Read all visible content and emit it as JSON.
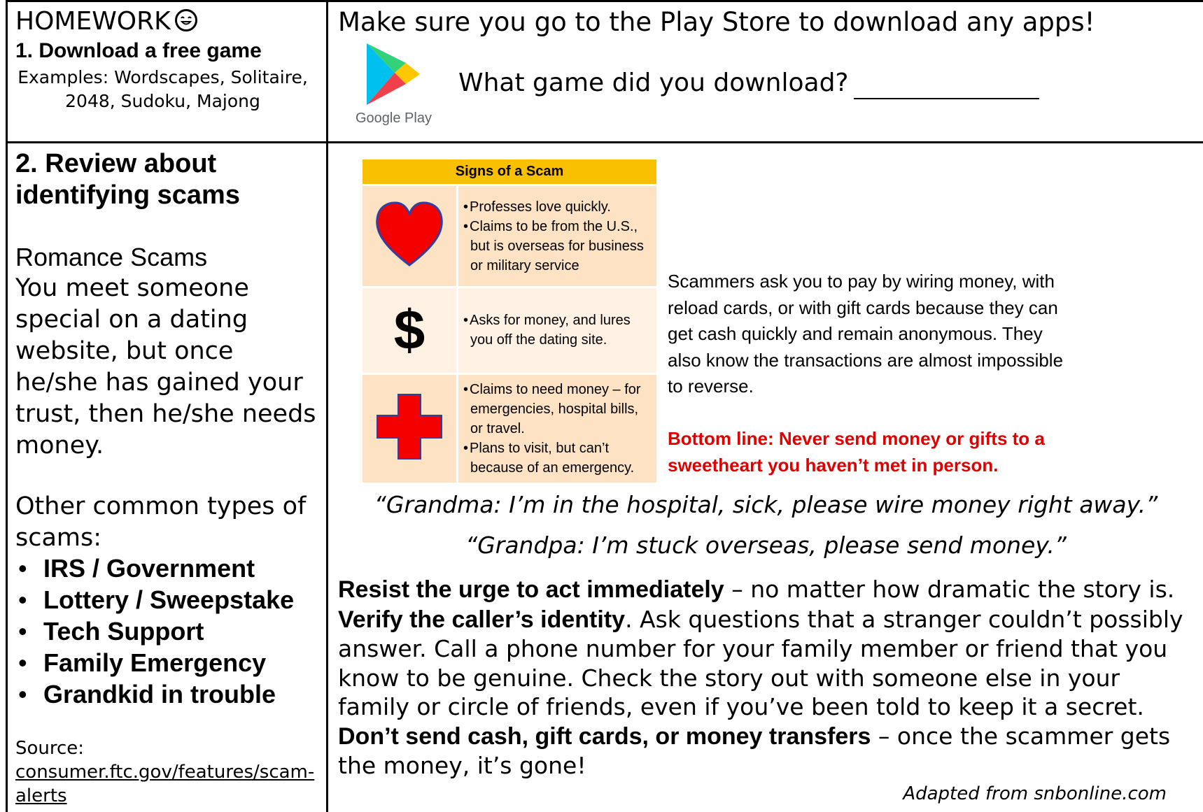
{
  "homework": {
    "title": "HOMEWORK",
    "item1": "1. Download a free game",
    "examples": "Examples: Wordscapes, Solitaire, 2048, Sudoku, Majong",
    "play_store_note": "Make sure you go to the Play Store to download any apps!",
    "logo_text": "Google Play",
    "question": "What game did you download?"
  },
  "review": {
    "title": "2. Review about identifying scams",
    "romance_title": "Romance Scams",
    "romance_body": "You meet someone special on a dating website, but once he/she has gained your trust, then he/she needs money.",
    "other_title": "Other common types of scams:",
    "types": [
      "IRS / Government",
      "Lottery / Sweepstake",
      "Tech Support",
      "Family Emergency",
      "Grandkid in trouble"
    ],
    "source_label": "Source:",
    "source_link": "consumer.ftc.gov/features/scam-alerts"
  },
  "signs_table": {
    "header": "Signs of a Scam",
    "rows": [
      {
        "icon": "heart-icon",
        "bullets": [
          "Professes love quickly.",
          "Claims to be from the U.S., but is overseas for business or military service"
        ]
      },
      {
        "icon": "$",
        "bullets": [
          "Asks for money, and lures you off the dating site."
        ]
      },
      {
        "icon": "red-cross-icon",
        "bullets": [
          "Claims to need money – for emergencies, hospital bills, or travel.",
          "Plans to visit, but can’t because of an emergency."
        ]
      }
    ]
  },
  "scam_text": "Scammers ask you to pay by wiring money, with reload cards, or with gift cards because they can get cash quickly and remain anonymous. They also know the transactions are almost impossible to reverse.",
  "bottom_line": "Bottom line: Never send money or gifts to a sweetheart you haven’t met in person.",
  "quotes": [
    "“Grandma: I’m in the hospital, sick, please wire money right away.”",
    "“Grandpa: I’m stuck overseas, please send money.”"
  ],
  "advice": [
    {
      "bold": "Resist the urge to act immediately",
      "text": " – no matter how dramatic the story is."
    },
    {
      "bold": "Verify the caller’s identity",
      "text": ". Ask questions that a stranger couldn’t possibly answer. Call a phone number for your family member or friend that you know to be genuine. Check the story out with someone else in your family or circle of friends, even if you’ve been told to keep it a secret."
    },
    {
      "bold": "Don’t send cash, gift cards, or money transfers",
      "text": " – once the scammer gets the money, it’s gone!"
    }
  ],
  "adapted": "Adapted from snbonline.com",
  "colors": {
    "scam_red": "#e00000",
    "table_header": "#f8c000",
    "table_row": "#fde2c4"
  }
}
